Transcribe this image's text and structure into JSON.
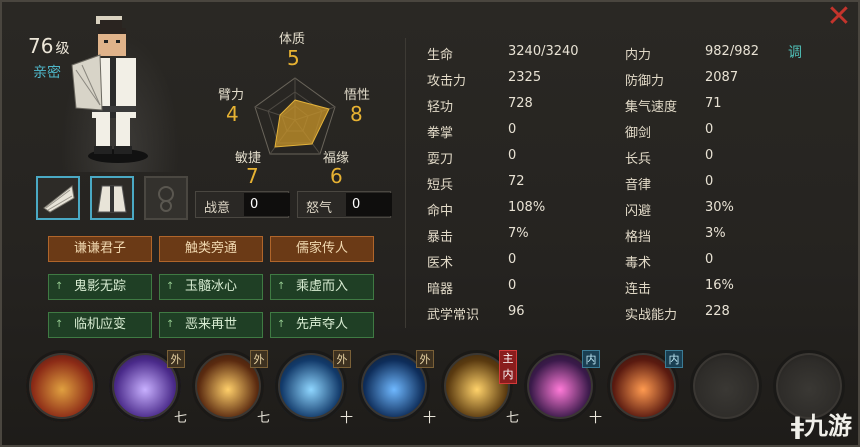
{
  "character": {
    "level": "76",
    "level_unit": "级",
    "relation": "亲密"
  },
  "radar": {
    "stats": [
      {
        "label": "体质",
        "value": "5"
      },
      {
        "label": "悟性",
        "value": "8"
      },
      {
        "label": "福缘",
        "value": "6"
      },
      {
        "label": "敏捷",
        "value": "7"
      },
      {
        "label": "臂力",
        "value": "4"
      }
    ]
  },
  "boxes": {
    "battle_label": "战意",
    "battle_value": "0",
    "rage_label": "怒气",
    "rage_value": "0"
  },
  "traits": [
    {
      "label": "谦谦君子",
      "style": "orange",
      "arrow": ""
    },
    {
      "label": "触类旁通",
      "style": "orange",
      "arrow": ""
    },
    {
      "label": "儒家传人",
      "style": "orange",
      "arrow": ""
    },
    {
      "label": "鬼影无踪",
      "style": "green",
      "arrow": "↑"
    },
    {
      "label": "玉髓冰心",
      "style": "green",
      "arrow": "↑"
    },
    {
      "label": "乘虚而入",
      "style": "green",
      "arrow": "↑"
    },
    {
      "label": "临机应变",
      "style": "green",
      "arrow": "↑"
    },
    {
      "label": "恶来再世",
      "style": "green",
      "arrow": "↑"
    },
    {
      "label": "先声夺人",
      "style": "green",
      "arrow": "↑"
    }
  ],
  "attributes_left": [
    {
      "label": "生命",
      "value": "3240/3240"
    },
    {
      "label": "攻击力",
      "value": "2325"
    },
    {
      "label": "轻功",
      "value": "728"
    },
    {
      "label": "拳掌",
      "value": "0"
    },
    {
      "label": "耍刀",
      "value": "0"
    },
    {
      "label": "短兵",
      "value": "72"
    },
    {
      "label": "命中",
      "value": "108%"
    },
    {
      "label": "暴击",
      "value": "7%"
    },
    {
      "label": "医术",
      "value": "0"
    },
    {
      "label": "暗器",
      "value": "0"
    },
    {
      "label": "武学常识",
      "value": "96"
    }
  ],
  "attributes_right": [
    {
      "label": "内力",
      "value": "982/982"
    },
    {
      "label": "防御力",
      "value": "2087"
    },
    {
      "label": "集气速度",
      "value": "71"
    },
    {
      "label": "御剑",
      "value": "0"
    },
    {
      "label": "长兵",
      "value": "0"
    },
    {
      "label": "音律",
      "value": "0"
    },
    {
      "label": "闪避",
      "value": "30%"
    },
    {
      "label": "格挡",
      "value": "3%"
    },
    {
      "label": "毒术",
      "value": "0"
    },
    {
      "label": "连击",
      "value": "16%"
    },
    {
      "label": "实战能力",
      "value": "228"
    }
  ],
  "tune_label": "调",
  "close_icon": "✕",
  "skills": [
    {
      "name": "scroll-skill-icon",
      "color": "#8b2a16",
      "glow": "#e0a040",
      "tag": "",
      "tag_style": "",
      "level": ""
    },
    {
      "name": "fan-wind-skill-icon",
      "color": "#4a2a8a",
      "glow": "#c8b0ff",
      "tag": "外",
      "tag_style": "wai",
      "level": "七"
    },
    {
      "name": "fan-fire-skill-icon",
      "color": "#5a2a10",
      "glow": "#ffcf6a",
      "tag": "外",
      "tag_style": "wai",
      "level": "七"
    },
    {
      "name": "water-skill-icon",
      "color": "#123a6a",
      "glow": "#8fd6ff",
      "tag": "外",
      "tag_style": "wai",
      "level": "十"
    },
    {
      "name": "vortex-skill-icon",
      "color": "#0e2d5a",
      "glow": "#6fb8ff",
      "tag": "外",
      "tag_style": "wai",
      "level": "十"
    },
    {
      "name": "inner-skill-icon",
      "color": "#5a3a10",
      "glow": "#ffd26a",
      "tag": "主内",
      "tag_style": "zhu",
      "level": "七"
    },
    {
      "name": "comet-skill-icon",
      "color": "#3a1a4a",
      "glow": "#ff7ad8",
      "tag": "内",
      "tag_style": "nei",
      "level": "十"
    },
    {
      "name": "flame-skill-icon",
      "color": "#5a1a10",
      "glow": "#ff9a50",
      "tag": "内",
      "tag_style": "nei",
      "level": ""
    },
    {
      "name": "empty-skill-slot",
      "color": "#2e2c29",
      "glow": "#3a3834",
      "tag": "",
      "tag_style": "",
      "level": ""
    },
    {
      "name": "empty-skill-slot",
      "color": "#2e2c29",
      "glow": "#3a3834",
      "tag": "",
      "tag_style": "",
      "level": ""
    }
  ],
  "watermark": {
    "prefix": "ǂ",
    "text": "九游"
  }
}
